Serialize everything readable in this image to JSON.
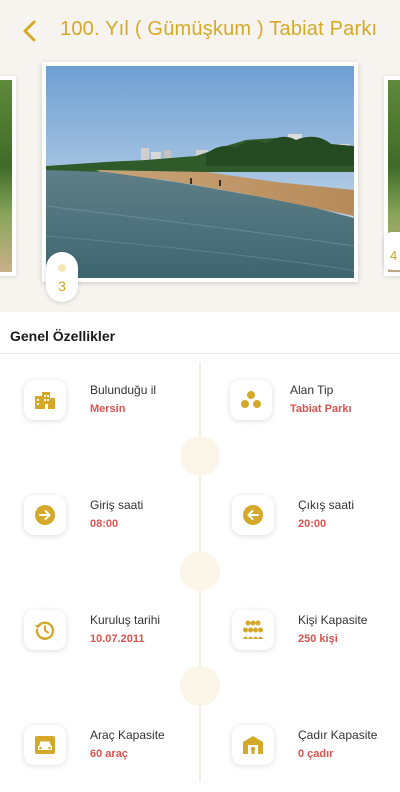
{
  "header": {
    "title": "100. Yıl  ( Gümüşkum ) Tabiat Parkı",
    "back_icon": "chevron-left-icon",
    "accent_color": "#d4a92a"
  },
  "carousel": {
    "current_page": "3",
    "next_page_partial": "4"
  },
  "section": {
    "title": "Genel Özellikler"
  },
  "features": [
    {
      "icon": "building-icon",
      "label": "Bulunduğu il",
      "value": "Mersin"
    },
    {
      "icon": "area-type-icon",
      "label": "Alan Tip",
      "value": "Tabiat Parkı"
    },
    {
      "icon": "entry-arrow-icon",
      "label": "Giriş saati",
      "value": "08:00"
    },
    {
      "icon": "exit-arrow-icon",
      "label": "Çıkış saati",
      "value": "20:00"
    },
    {
      "icon": "history-icon",
      "label": "Kuruluş tarihi",
      "value": "10.07.2011"
    },
    {
      "icon": "people-icon",
      "label": "Kişi Kapasite",
      "value": "250 kişi"
    },
    {
      "icon": "car-icon",
      "label": "Araç Kapasite",
      "value": "60 araç"
    },
    {
      "icon": "tent-icon",
      "label": "Çadır Kapasite",
      "value": "0 çadır"
    }
  ],
  "colors": {
    "value_red": "#d9534f",
    "icon_gold": "#d4a92a",
    "header_bg": "#f7f4ef"
  }
}
